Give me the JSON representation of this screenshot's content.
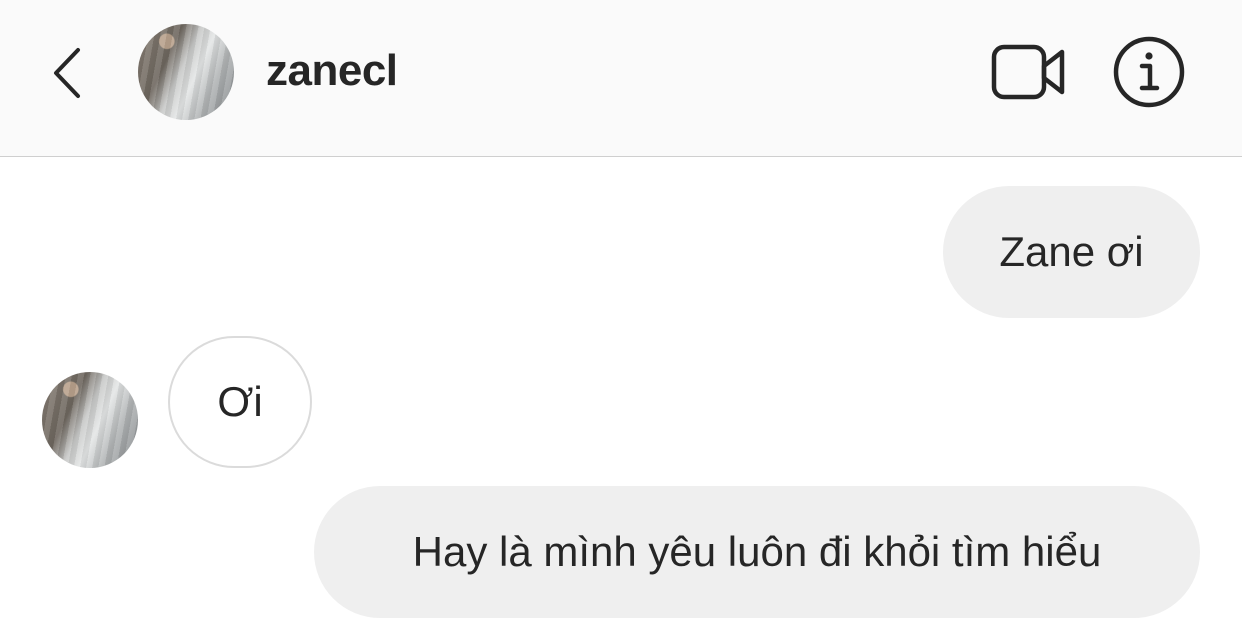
{
  "header": {
    "username": "zanecl",
    "icons": {
      "back": "chevron-left-icon",
      "video": "video-camera-icon",
      "info": "info-icon"
    }
  },
  "messages": [
    {
      "direction": "outgoing",
      "text": "Zane ơi"
    },
    {
      "direction": "incoming",
      "text": "Ơi"
    },
    {
      "direction": "outgoing",
      "text": "Hay là mình yêu luôn đi khỏi tìm hiểu"
    }
  ],
  "colors": {
    "header_bg": "#fafafa",
    "outgoing_bubble": "#efefef",
    "incoming_border": "#dbdbdb",
    "text": "#262626"
  }
}
